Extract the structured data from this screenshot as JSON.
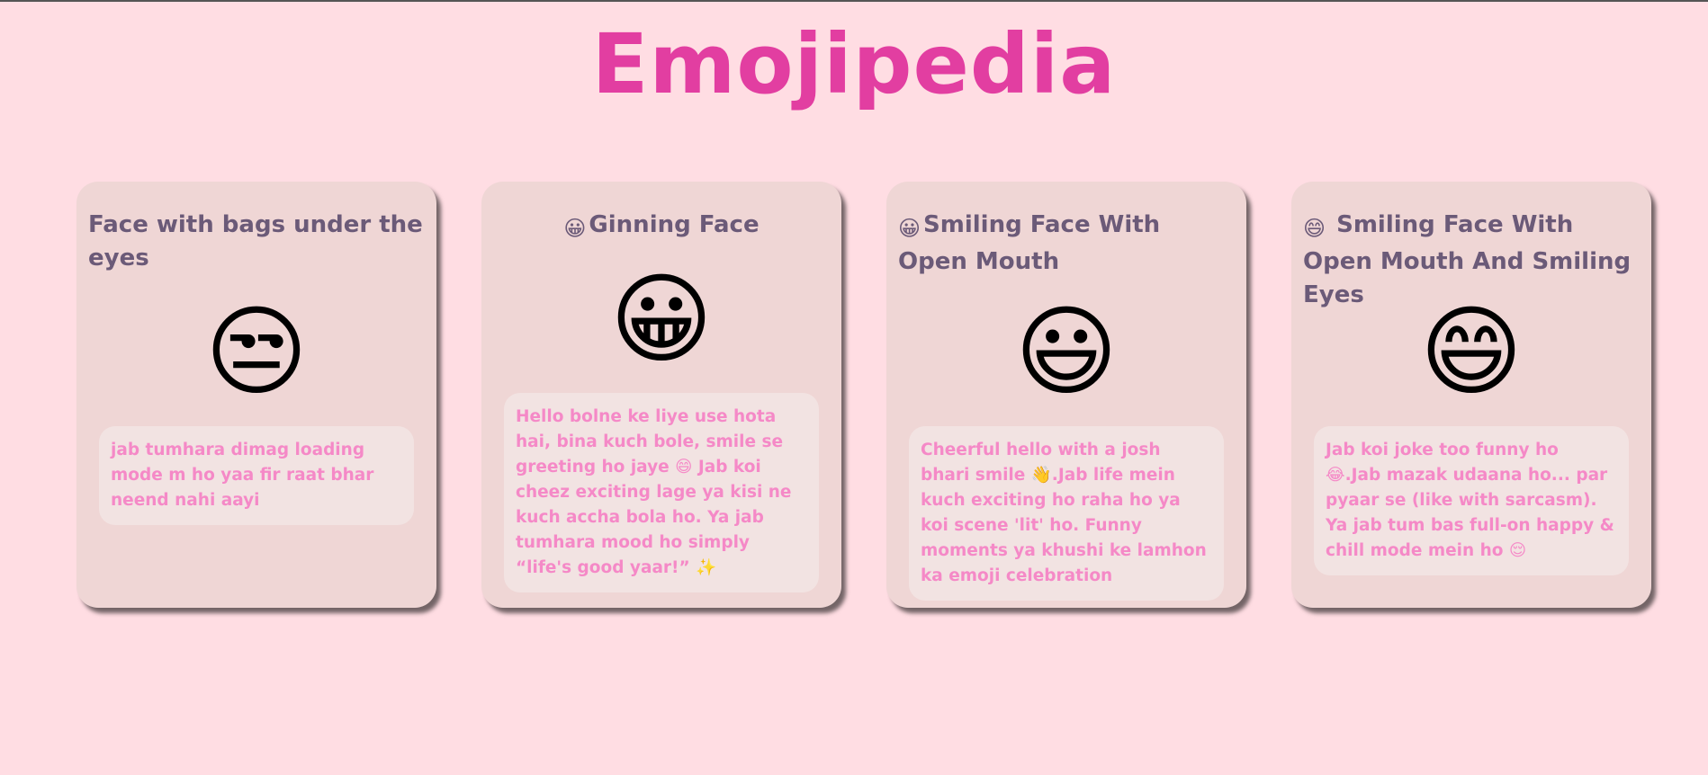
{
  "header": {
    "title": "Emojipedia"
  },
  "cards": [
    {
      "title": "Face with bags under the eyes",
      "title_icon": "",
      "emoji": "😒",
      "emoji_name": "face-with-bags-under-eyes-icon",
      "description": "jab tumhara dimag loading mode m ho yaa fir raat bhar neend nahi aayi"
    },
    {
      "title": "Ginning Face",
      "title_icon": "😀",
      "emoji": "😀",
      "emoji_name": "grinning-face-icon",
      "description": "Hello bolne ke liye use hota hai, bina kuch bole, smile se greeting ho jaye 😄 Jab koi cheez exciting lage ya kisi ne kuch accha bola ho. Ya jab tumhara mood ho simply “life's good yaar!” ✨"
    },
    {
      "title": "Smiling Face With Open Mouth",
      "title_icon": "😀",
      "emoji": "😃",
      "emoji_name": "smiling-face-open-mouth-icon",
      "description": "Cheerful hello with a josh bhari smile 👋.Jab life mein kuch exciting ho raha ho ya koi scene 'lit' ho. Funny moments ya khushi ke lamhon ka emoji celebration"
    },
    {
      "title": "Smiling Face With Open Mouth And Smiling Eyes",
      "title_icon": "😄",
      "emoji": "😄",
      "emoji_name": "smiling-face-open-mouth-smiling-eyes-icon",
      "description": "Jab koi joke too funny ho 😂.Jab mazak udaana ho... par pyaar se (like with sarcasm). Ya jab tum bas full-on happy & chill mode mein ho 😌"
    }
  ]
}
